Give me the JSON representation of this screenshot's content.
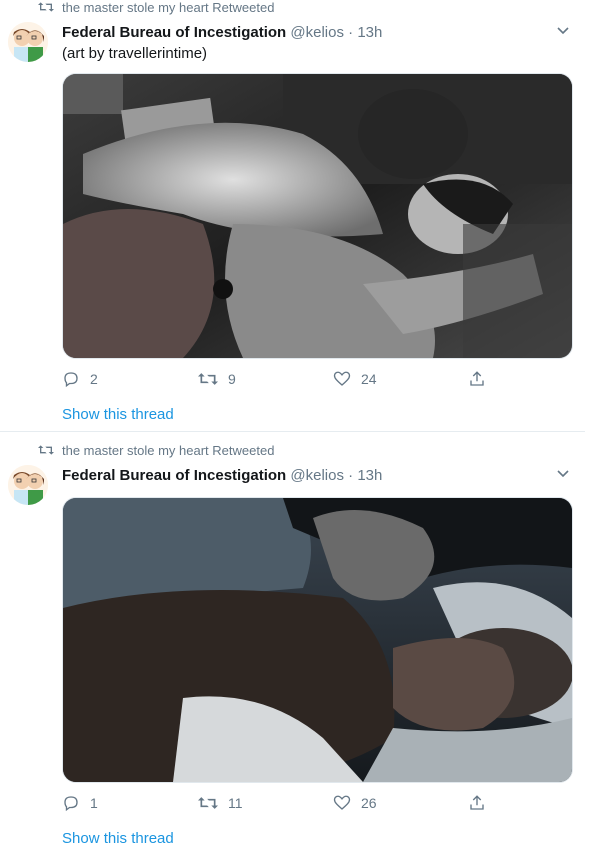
{
  "tweets": [
    {
      "retweet_text": "the master stole my heart Retweeted",
      "display_name": "Federal Bureau of Incestigation",
      "handle": "@kelios",
      "dot": "·",
      "time": "13h",
      "text": "(art by travellerintime)",
      "replies": "2",
      "retweets": "9",
      "likes": "24",
      "thread_link": "Show this thread"
    },
    {
      "retweet_text": "the master stole my heart Retweeted",
      "display_name": "Federal Bureau of Incestigation",
      "handle": "@kelios",
      "dot": "·",
      "time": "13h",
      "replies": "1",
      "retweets": "11",
      "likes": "26",
      "thread_link": "Show this thread"
    }
  ],
  "colors": {
    "text_primary": "#14171a",
    "text_secondary": "#657786",
    "link": "#1b95e0",
    "divider": "#e6ecf0"
  },
  "icons": [
    "retweet-icon",
    "chevron-down-icon",
    "reply-icon",
    "like-icon",
    "share-icon"
  ]
}
